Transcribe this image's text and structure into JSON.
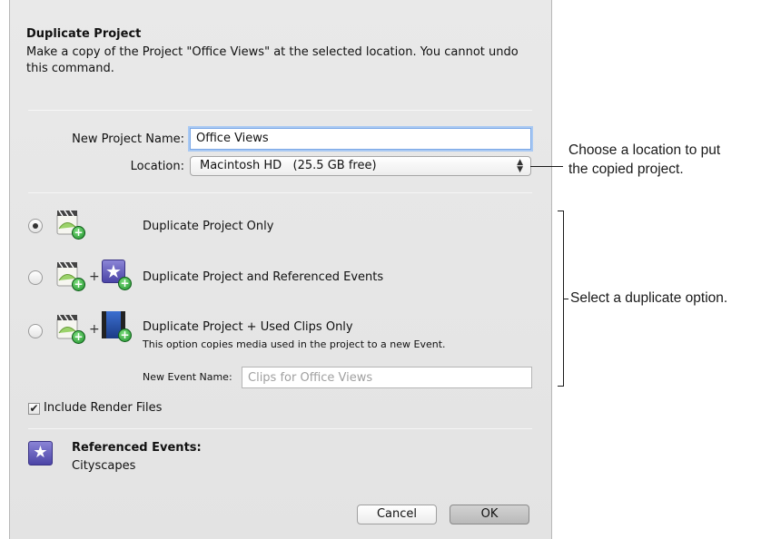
{
  "dialog": {
    "title": "Duplicate Project",
    "description": "Make a copy of the Project \"Office Views\" at the selected location. You cannot undo this command."
  },
  "form": {
    "project_name_label": "New Project Name:",
    "project_name_value": "Office Views",
    "location_label": "Location:",
    "location_value": "Macintosh HD   (25.5 GB free)"
  },
  "options": [
    {
      "label": "Duplicate Project Only",
      "selected": true
    },
    {
      "label": "Duplicate Project and Referenced Events",
      "selected": false
    },
    {
      "label": "Duplicate Project + Used Clips Only",
      "sublabel": "This option copies media used in the project to a new Event.",
      "selected": false
    }
  ],
  "event": {
    "label": "New Event Name:",
    "placeholder": "Clips for Office Views"
  },
  "render": {
    "label": "Include Render Files",
    "checked": true
  },
  "referenced": {
    "heading": "Referenced Events:",
    "value": "Cityscapes"
  },
  "buttons": {
    "cancel": "Cancel",
    "ok": "OK"
  },
  "callouts": {
    "location_line1": "Choose a location to put",
    "location_line2": "the copied project.",
    "options": "Select a duplicate option."
  },
  "icons": {
    "radio_on": "radio-selected",
    "clip": "project-clip-icon",
    "plus": "+",
    "star": "★",
    "check": "✔"
  }
}
